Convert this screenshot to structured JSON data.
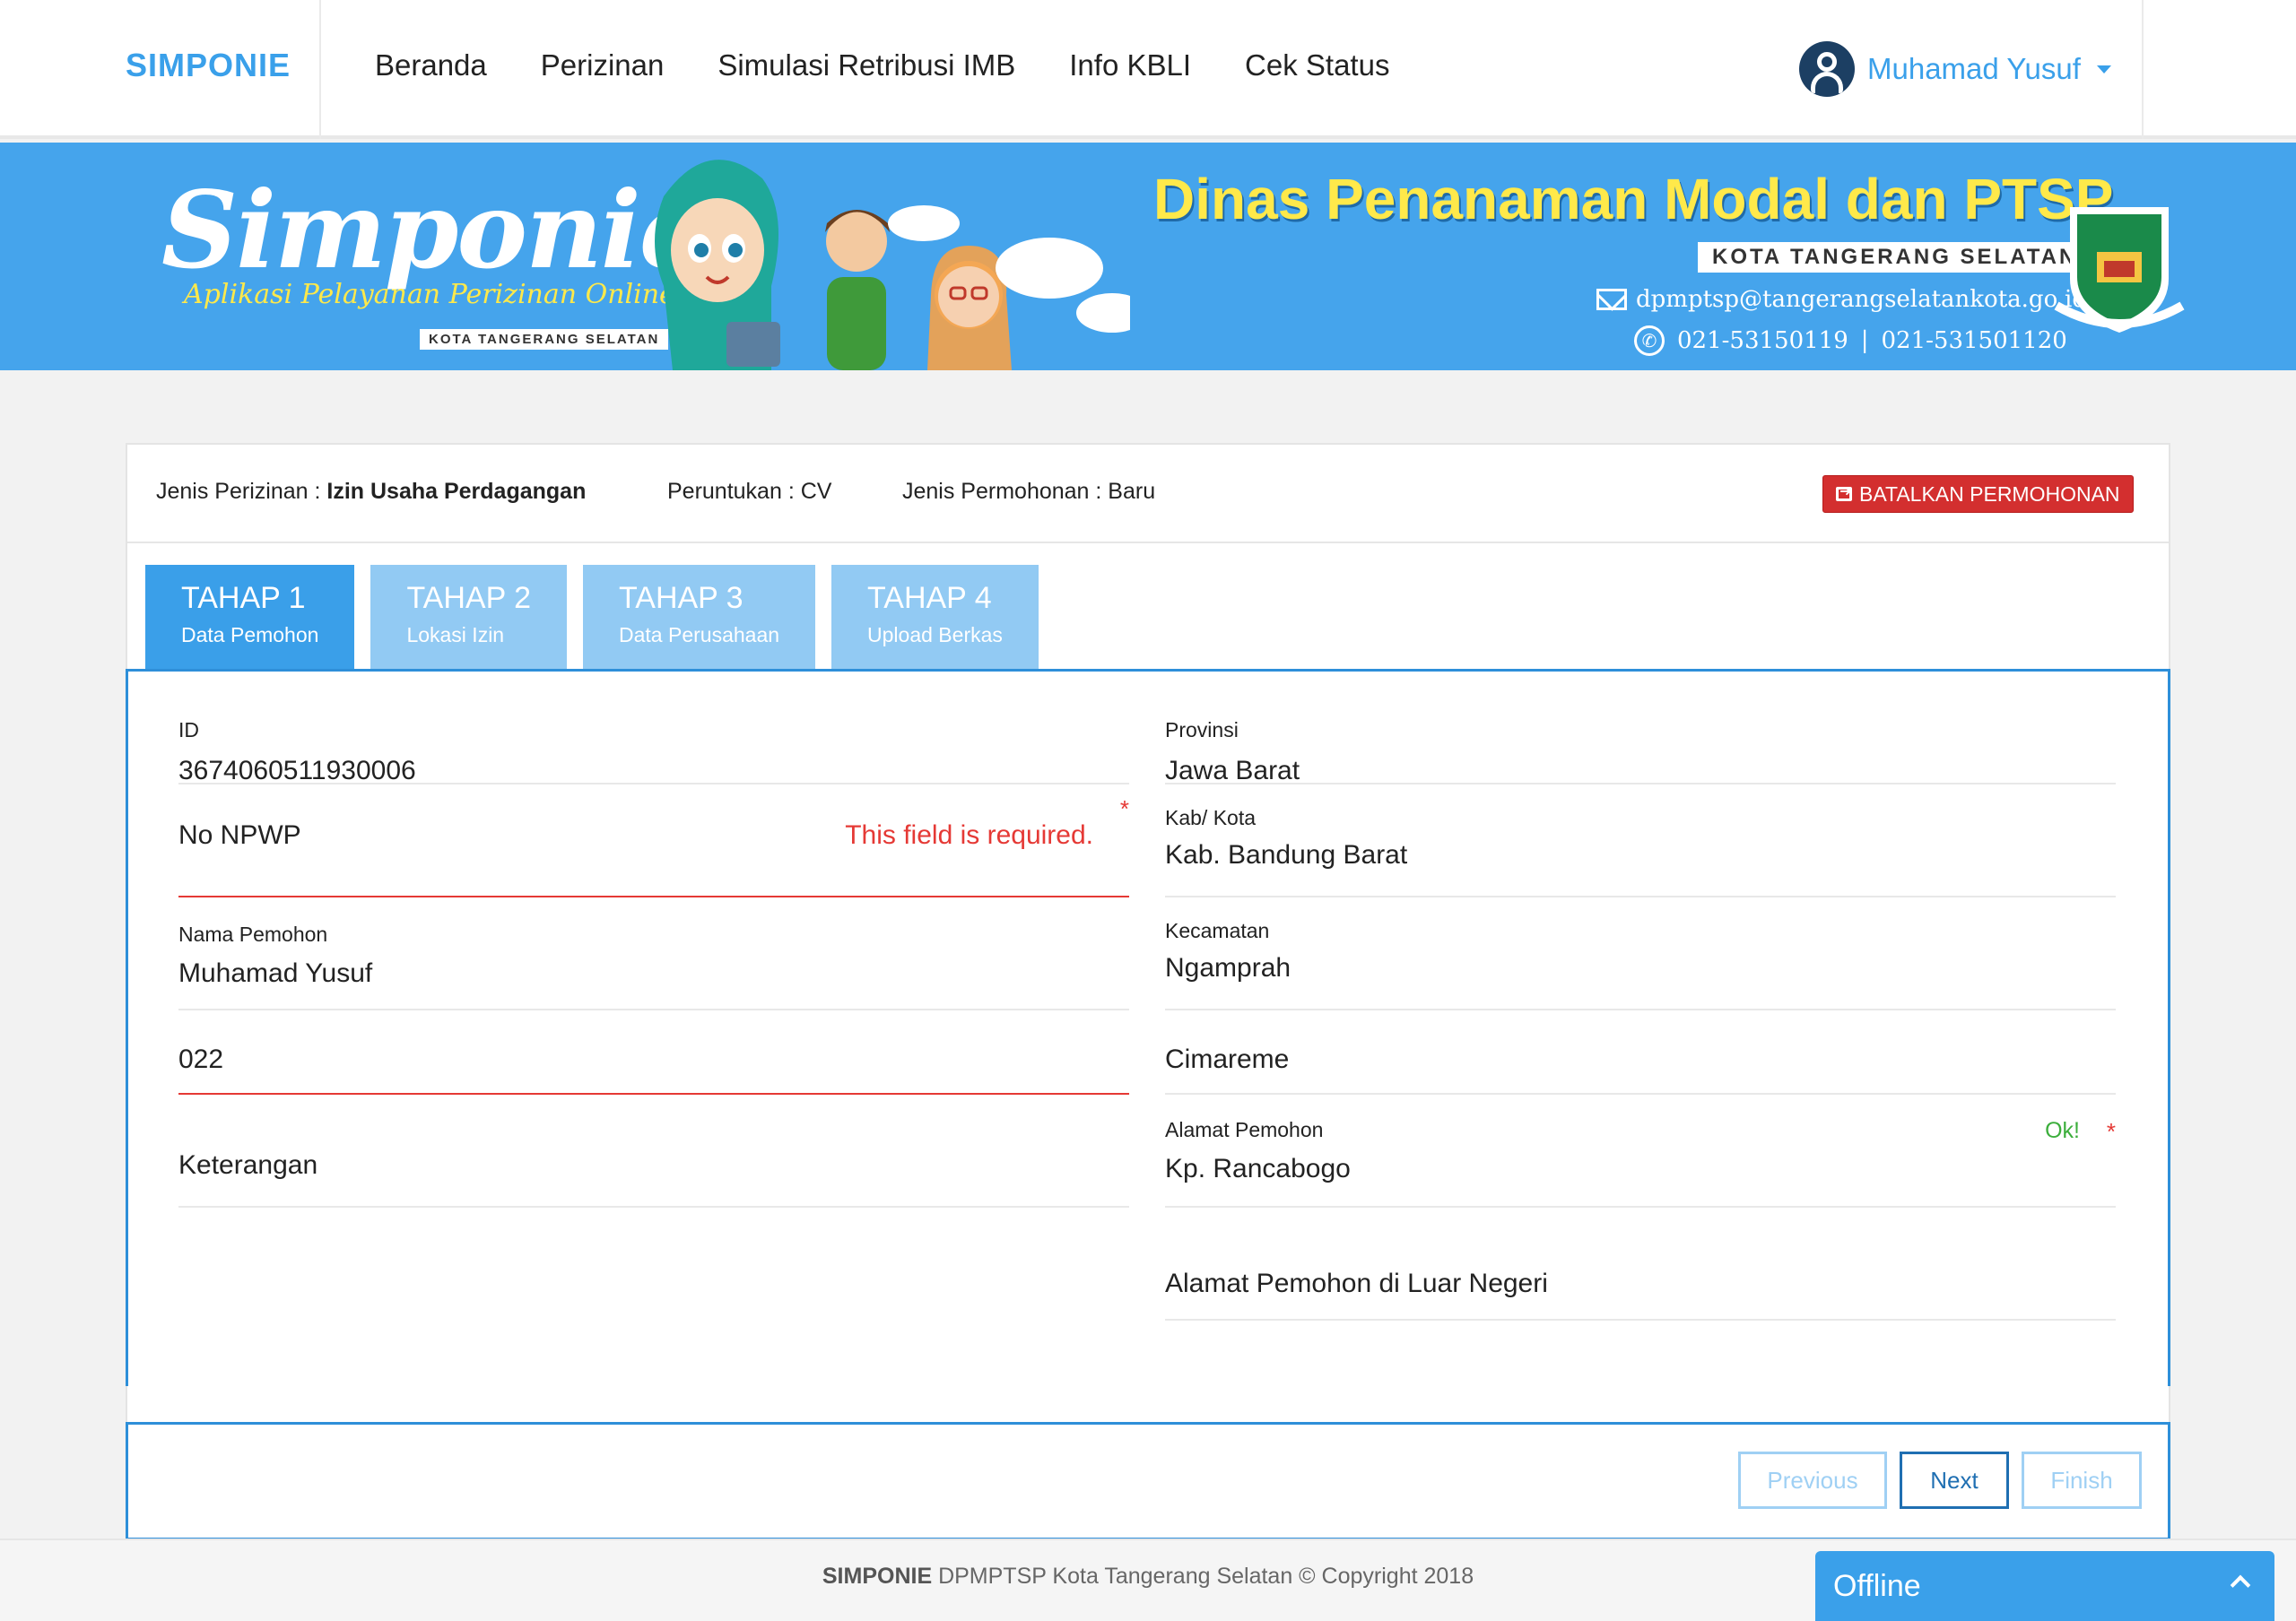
{
  "navbar": {
    "brand": "SIMPONIE",
    "links": [
      "Beranda",
      "Perizinan",
      "Simulasi Retribusi IMB",
      "Info KBLI",
      "Cek Status"
    ],
    "user": "Muhamad Yusuf"
  },
  "banner": {
    "logo": "Simponie",
    "tagline": "Aplikasi Pelayanan Perizinan Online",
    "logo_sub": "KOTA TANGERANG SELATAN",
    "title": "Dinas Penanaman Modal dan PTSP",
    "city": "KOTA TANGERANG SELATAN",
    "email": "dpmptsp@tangerangselatankota.go.id",
    "phone1": "021-53150119",
    "separator": "|",
    "phone2": "021-531501120"
  },
  "header": {
    "jenis_label": "Jenis Perizinan :",
    "jenis_value": "Izin Usaha Perdagangan",
    "peruntukan": "Peruntukan : CV",
    "permohonan": "Jenis Permohonan : Baru",
    "cancel_label": "BATALKAN PERMOHONAN"
  },
  "tabs": [
    {
      "title": "TAHAP 1",
      "subtitle": "Data Pemohon"
    },
    {
      "title": "TAHAP 2",
      "subtitle": "Lokasi Izin"
    },
    {
      "title": "TAHAP 3",
      "subtitle": "Data Perusahaan"
    },
    {
      "title": "TAHAP 4",
      "subtitle": "Upload Berkas"
    }
  ],
  "form": {
    "id": {
      "label": "ID",
      "value": "3674060511930006"
    },
    "npwp": {
      "placeholder": "No NPWP",
      "error": "This field is required.",
      "required": "*"
    },
    "nama": {
      "label": "Nama Pemohon",
      "value": "Muhamad Yusuf"
    },
    "phone": {
      "value": "022"
    },
    "keterangan": {
      "placeholder": "Keterangan"
    },
    "provinsi": {
      "label": "Provinsi",
      "value": "Jawa Barat"
    },
    "kabkota": {
      "label": "Kab/ Kota",
      "value": "Kab. Bandung Barat"
    },
    "kecamatan": {
      "label": "Kecamatan",
      "value": "Ngamprah"
    },
    "kelurahan": {
      "value": "Cimareme"
    },
    "alamat": {
      "label": "Alamat Pemohon",
      "value": "Kp. Rancabogo",
      "ok": "Ok!",
      "required": "*"
    },
    "alamat_ln": {
      "placeholder": "Alamat Pemohon di Luar Negeri"
    }
  },
  "buttons": {
    "previous": "Previous",
    "next": "Next",
    "finish": "Finish"
  },
  "footer": {
    "brand": "SIMPONIE",
    "text": "DPMPTSP Kota Tangerang Selatan © Copyright 2018"
  },
  "chat": {
    "status": "Offline"
  },
  "colors": {
    "primary": "#3aa0ea",
    "danger": "#d32f2f",
    "ok": "#3cae3c",
    "banner_title": "#ffe94a"
  }
}
